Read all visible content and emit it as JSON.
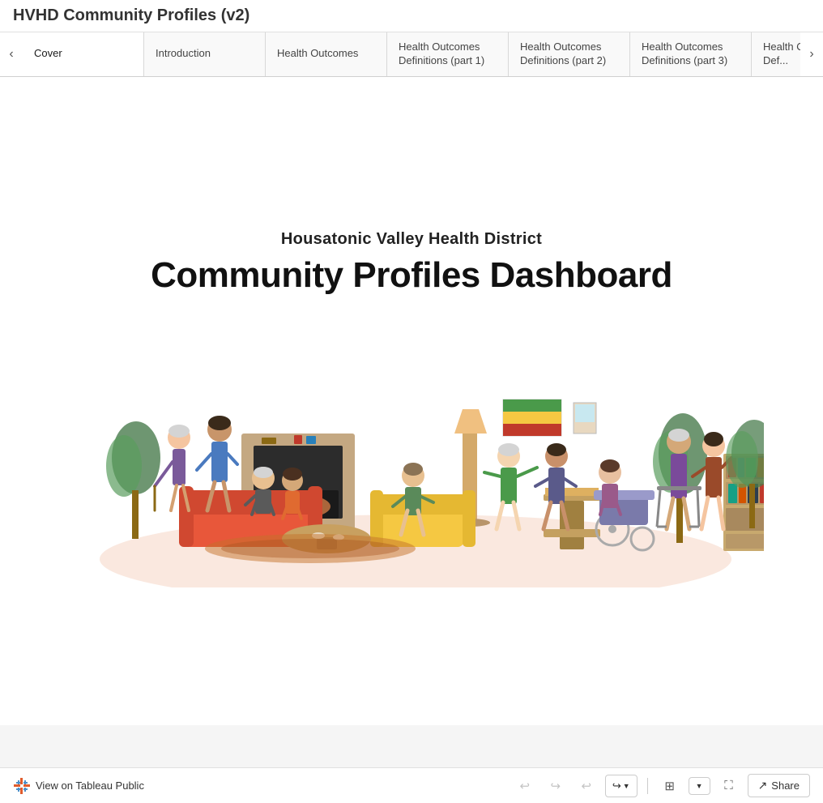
{
  "page": {
    "title": "HVHD Community Profiles (v2)"
  },
  "tabs": {
    "prev_label": "‹",
    "next_label": "›",
    "items": [
      {
        "id": "cover",
        "label": "Cover",
        "active": true
      },
      {
        "id": "introduction",
        "label": "Introduction",
        "active": false
      },
      {
        "id": "health-outcomes",
        "label": "Health Outcomes",
        "active": false
      },
      {
        "id": "health-outcomes-def-1",
        "label": "Health Outcomes Definitions (part 1)",
        "active": false
      },
      {
        "id": "health-outcomes-def-2",
        "label": "Health Outcomes Definitions (part 2)",
        "active": false
      },
      {
        "id": "health-outcomes-def-3",
        "label": "Health Outcomes Definitions (part 3)",
        "active": false
      },
      {
        "id": "health-outcomes-def-4",
        "label": "Health Outcomes Def...",
        "active": false
      }
    ]
  },
  "dashboard": {
    "subtitle": "Housatonic Valley Health District",
    "title": "Community Profiles Dashboard"
  },
  "toolbar": {
    "undo_label": "↩",
    "redo_label": "↪",
    "undo2_label": "↩",
    "redo2_label": "↪",
    "view_public_label": "View on Tableau Public",
    "present_label": "⊞",
    "fullscreen_label": "⛶",
    "share_label": "Share",
    "share_icon": "↗"
  }
}
